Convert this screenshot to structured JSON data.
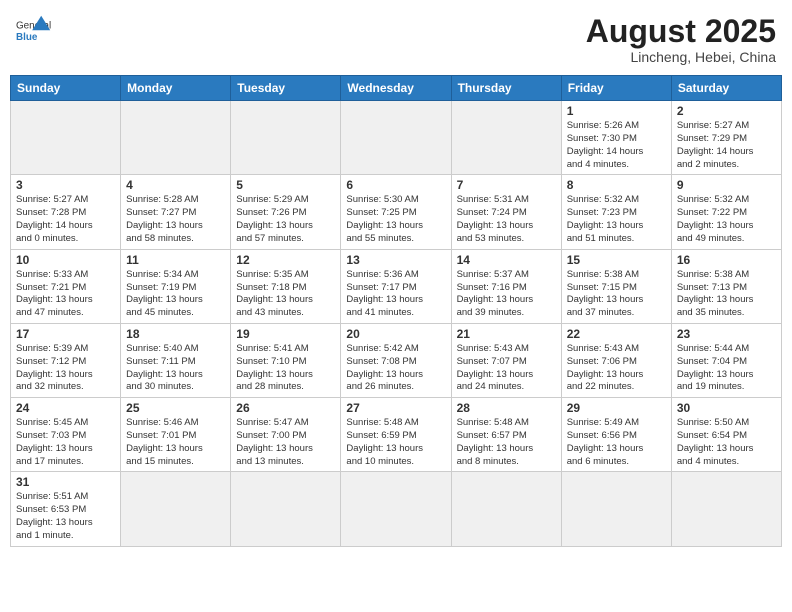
{
  "header": {
    "logo_general": "General",
    "logo_blue": "Blue",
    "month_year": "August 2025",
    "location": "Lincheng, Hebei, China"
  },
  "weekdays": [
    "Sunday",
    "Monday",
    "Tuesday",
    "Wednesday",
    "Thursday",
    "Friday",
    "Saturday"
  ],
  "weeks": [
    [
      {
        "day": "",
        "info": ""
      },
      {
        "day": "",
        "info": ""
      },
      {
        "day": "",
        "info": ""
      },
      {
        "day": "",
        "info": ""
      },
      {
        "day": "",
        "info": ""
      },
      {
        "day": "1",
        "info": "Sunrise: 5:26 AM\nSunset: 7:30 PM\nDaylight: 14 hours\nand 4 minutes."
      },
      {
        "day": "2",
        "info": "Sunrise: 5:27 AM\nSunset: 7:29 PM\nDaylight: 14 hours\nand 2 minutes."
      }
    ],
    [
      {
        "day": "3",
        "info": "Sunrise: 5:27 AM\nSunset: 7:28 PM\nDaylight: 14 hours\nand 0 minutes."
      },
      {
        "day": "4",
        "info": "Sunrise: 5:28 AM\nSunset: 7:27 PM\nDaylight: 13 hours\nand 58 minutes."
      },
      {
        "day": "5",
        "info": "Sunrise: 5:29 AM\nSunset: 7:26 PM\nDaylight: 13 hours\nand 57 minutes."
      },
      {
        "day": "6",
        "info": "Sunrise: 5:30 AM\nSunset: 7:25 PM\nDaylight: 13 hours\nand 55 minutes."
      },
      {
        "day": "7",
        "info": "Sunrise: 5:31 AM\nSunset: 7:24 PM\nDaylight: 13 hours\nand 53 minutes."
      },
      {
        "day": "8",
        "info": "Sunrise: 5:32 AM\nSunset: 7:23 PM\nDaylight: 13 hours\nand 51 minutes."
      },
      {
        "day": "9",
        "info": "Sunrise: 5:32 AM\nSunset: 7:22 PM\nDaylight: 13 hours\nand 49 minutes."
      }
    ],
    [
      {
        "day": "10",
        "info": "Sunrise: 5:33 AM\nSunset: 7:21 PM\nDaylight: 13 hours\nand 47 minutes."
      },
      {
        "day": "11",
        "info": "Sunrise: 5:34 AM\nSunset: 7:19 PM\nDaylight: 13 hours\nand 45 minutes."
      },
      {
        "day": "12",
        "info": "Sunrise: 5:35 AM\nSunset: 7:18 PM\nDaylight: 13 hours\nand 43 minutes."
      },
      {
        "day": "13",
        "info": "Sunrise: 5:36 AM\nSunset: 7:17 PM\nDaylight: 13 hours\nand 41 minutes."
      },
      {
        "day": "14",
        "info": "Sunrise: 5:37 AM\nSunset: 7:16 PM\nDaylight: 13 hours\nand 39 minutes."
      },
      {
        "day": "15",
        "info": "Sunrise: 5:38 AM\nSunset: 7:15 PM\nDaylight: 13 hours\nand 37 minutes."
      },
      {
        "day": "16",
        "info": "Sunrise: 5:38 AM\nSunset: 7:13 PM\nDaylight: 13 hours\nand 35 minutes."
      }
    ],
    [
      {
        "day": "17",
        "info": "Sunrise: 5:39 AM\nSunset: 7:12 PM\nDaylight: 13 hours\nand 32 minutes."
      },
      {
        "day": "18",
        "info": "Sunrise: 5:40 AM\nSunset: 7:11 PM\nDaylight: 13 hours\nand 30 minutes."
      },
      {
        "day": "19",
        "info": "Sunrise: 5:41 AM\nSunset: 7:10 PM\nDaylight: 13 hours\nand 28 minutes."
      },
      {
        "day": "20",
        "info": "Sunrise: 5:42 AM\nSunset: 7:08 PM\nDaylight: 13 hours\nand 26 minutes."
      },
      {
        "day": "21",
        "info": "Sunrise: 5:43 AM\nSunset: 7:07 PM\nDaylight: 13 hours\nand 24 minutes."
      },
      {
        "day": "22",
        "info": "Sunrise: 5:43 AM\nSunset: 7:06 PM\nDaylight: 13 hours\nand 22 minutes."
      },
      {
        "day": "23",
        "info": "Sunrise: 5:44 AM\nSunset: 7:04 PM\nDaylight: 13 hours\nand 19 minutes."
      }
    ],
    [
      {
        "day": "24",
        "info": "Sunrise: 5:45 AM\nSunset: 7:03 PM\nDaylight: 13 hours\nand 17 minutes."
      },
      {
        "day": "25",
        "info": "Sunrise: 5:46 AM\nSunset: 7:01 PM\nDaylight: 13 hours\nand 15 minutes."
      },
      {
        "day": "26",
        "info": "Sunrise: 5:47 AM\nSunset: 7:00 PM\nDaylight: 13 hours\nand 13 minutes."
      },
      {
        "day": "27",
        "info": "Sunrise: 5:48 AM\nSunset: 6:59 PM\nDaylight: 13 hours\nand 10 minutes."
      },
      {
        "day": "28",
        "info": "Sunrise: 5:48 AM\nSunset: 6:57 PM\nDaylight: 13 hours\nand 8 minutes."
      },
      {
        "day": "29",
        "info": "Sunrise: 5:49 AM\nSunset: 6:56 PM\nDaylight: 13 hours\nand 6 minutes."
      },
      {
        "day": "30",
        "info": "Sunrise: 5:50 AM\nSunset: 6:54 PM\nDaylight: 13 hours\nand 4 minutes."
      }
    ],
    [
      {
        "day": "31",
        "info": "Sunrise: 5:51 AM\nSunset: 6:53 PM\nDaylight: 13 hours\nand 1 minute."
      },
      {
        "day": "",
        "info": ""
      },
      {
        "day": "",
        "info": ""
      },
      {
        "day": "",
        "info": ""
      },
      {
        "day": "",
        "info": ""
      },
      {
        "day": "",
        "info": ""
      },
      {
        "day": "",
        "info": ""
      }
    ]
  ]
}
